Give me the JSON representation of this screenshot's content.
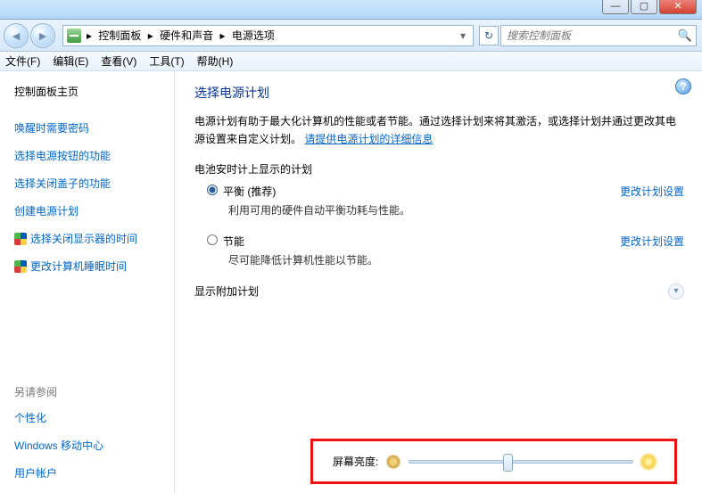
{
  "titlebar": {
    "minimize_glyph": "—",
    "maximize_glyph": "▢",
    "close_glyph": "✕"
  },
  "address": {
    "nav_back_glyph": "◄",
    "nav_fwd_glyph": "►",
    "crumb1": "控制面板",
    "sep": "▸",
    "crumb2": "硬件和声音",
    "crumb3": "电源选项",
    "dd_glyph": "▾",
    "refresh_glyph": "↻"
  },
  "search": {
    "placeholder": "搜索控制面板",
    "mag_glyph": "🔍"
  },
  "menu": {
    "file": "文件(F)",
    "edit": "编辑(E)",
    "view": "查看(V)",
    "tools": "工具(T)",
    "help": "帮助(H)"
  },
  "sidebar": {
    "home": "控制面板主页",
    "items": [
      "唤醒时需要密码",
      "选择电源按钮的功能",
      "选择关闭盖子的功能",
      "创建电源计划",
      "选择关闭显示器的时间",
      "更改计算机睡眠时间"
    ],
    "seealso_h": "另请参阅",
    "seealso": [
      "个性化",
      "Windows 移动中心",
      "用户帐户"
    ]
  },
  "content": {
    "help_glyph": "?",
    "heading": "选择电源计划",
    "desc_a": "电源计划有助于最大化计算机的性能或者节能。通过选择计划来将其激活，或选择计划并通过更改其电源设置来自定义计划。",
    "desc_link": "请提供电源计划的详细信息",
    "group_batt": "电池安时计上显示的计划",
    "plan1_label": "平衡 (推荐)",
    "plan1_sub": "利用可用的硬件自动平衡功耗与性能。",
    "plan2_label": "节能",
    "plan2_sub": "尽可能降低计算机性能以节能。",
    "change_link": "更改计划设置",
    "extra": "显示附加计划",
    "chev_glyph": "▾"
  },
  "brightness": {
    "label": "屏幕亮度:"
  }
}
